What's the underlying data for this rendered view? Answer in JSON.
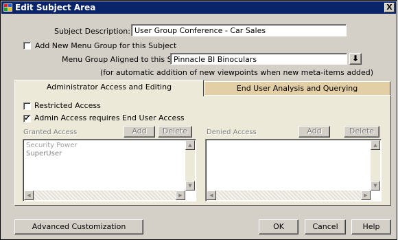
{
  "window": {
    "title": "Edit Subject Area",
    "close_glyph": "X"
  },
  "subject": {
    "description_label": "Subject Description:",
    "description_value": "User Group Conference - Car Sales"
  },
  "menu_group": {
    "add_new_label": "Add New Menu Group for this Subject",
    "add_new_checked": false,
    "aligned_label": "Menu Group Aligned to this Subject:",
    "aligned_value": "Pinnacle BI Binoculars",
    "note": "(for automatic addition of new viewpoints when new meta-items added)"
  },
  "tabs": [
    {
      "label": "Administrator Access and Editing",
      "active": true
    },
    {
      "label": "End User Analysis and Querying",
      "active": false
    }
  ],
  "access": {
    "restricted_label": "Restricted Access",
    "restricted_checked": false,
    "admin_requires_label": "Admin Access requires End User Access",
    "admin_requires_checked": true
  },
  "granted": {
    "label": "Granted Access",
    "add_label": "Add",
    "delete_label": "Delete",
    "items": [
      "Security Power",
      "SuperUser"
    ]
  },
  "denied": {
    "label": "Denied Access",
    "add_label": "Add",
    "delete_label": "Delete",
    "items": []
  },
  "footer": {
    "advanced_label": "Advanced Customization",
    "ok_label": "OK",
    "cancel_label": "Cancel",
    "help_label": "Help"
  },
  "glyphs": {
    "check": "✔",
    "down_arrow": "⬇",
    "scroll_up": "▲",
    "scroll_down": "▼",
    "scroll_left": "◀",
    "scroll_right": "▶"
  },
  "colors": {
    "titlebar": "#0a246a",
    "dialog": "#d4d0c8",
    "active_tab": "#ece9d8",
    "inactive_tab": "#e3cfa6"
  },
  "icons": {
    "app": "app-window-icon",
    "dropdown": "down-arrow-icon"
  }
}
